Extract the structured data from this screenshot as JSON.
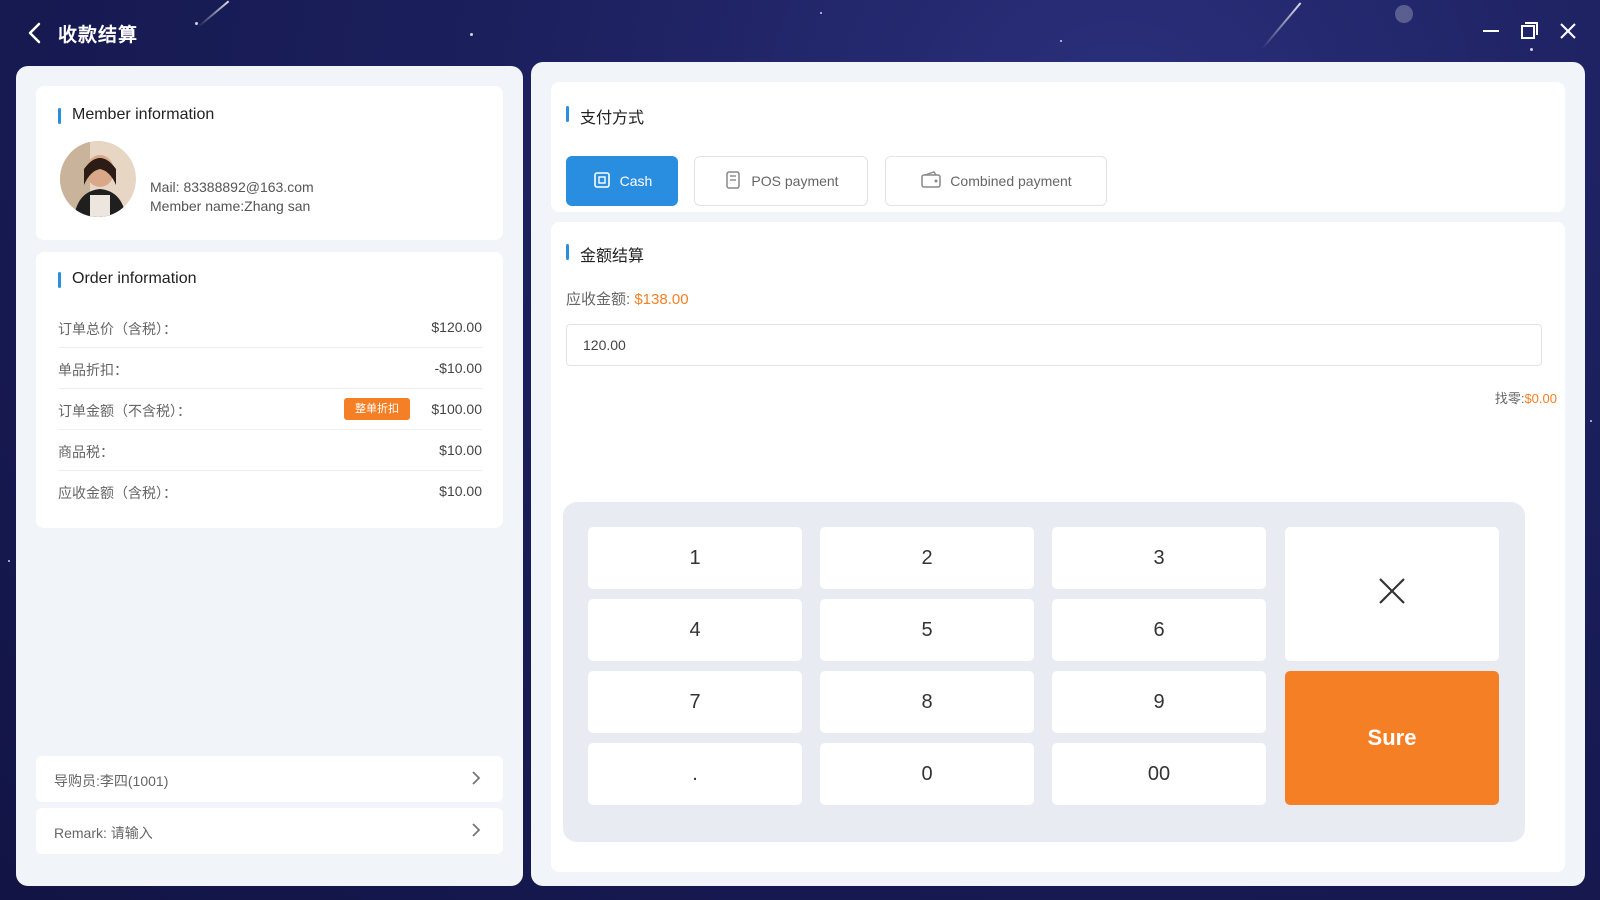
{
  "titlebar": {
    "title": "收款结算",
    "icons": [
      "back-icon",
      "minimize-icon",
      "maximize-icon",
      "close-icon"
    ]
  },
  "member": {
    "section_title": "Member information",
    "mail": "Mail: 83388892@163.com",
    "name": "Member name:Zhang san"
  },
  "order": {
    "section_title": "Order information",
    "rows": [
      {
        "label": "订单总价（含税）：",
        "value": "$120.00"
      },
      {
        "label": "单品折扣：",
        "value": "-$10.00"
      },
      {
        "label": "订单金额（不含税）：",
        "value": "$100.00",
        "tag": "整单折扣"
      },
      {
        "label": "商品税：",
        "value": "$10.00"
      },
      {
        "label": "应收金额（含税）：",
        "value": "$10.00"
      }
    ]
  },
  "bottom": {
    "guide": "导购员:李四(1001)",
    "remark": "Remark: 请输入"
  },
  "payment": {
    "section_title": "支付方式",
    "methods": [
      {
        "label": "Cash",
        "icon": "cash-icon",
        "selected": true
      },
      {
        "label": "POS payment",
        "icon": "pos-icon",
        "selected": false
      },
      {
        "label": "Combined payment",
        "icon": "wallet-icon",
        "selected": false
      }
    ],
    "accent_color": "#2a8ee0"
  },
  "amount": {
    "section_title": "金额结算",
    "due_label": "应收金额:",
    "due_value": "$138.00",
    "input_value": "120.00",
    "change_label": "找零:",
    "change_value": "$0.00",
    "highlight_color": "#f57f24"
  },
  "keypad": {
    "keys": [
      "1",
      "2",
      "3",
      "4",
      "5",
      "6",
      "7",
      "8",
      "9",
      ".",
      "0",
      "00"
    ],
    "delete_icon": "delete-icon",
    "sure_label": "Sure"
  }
}
